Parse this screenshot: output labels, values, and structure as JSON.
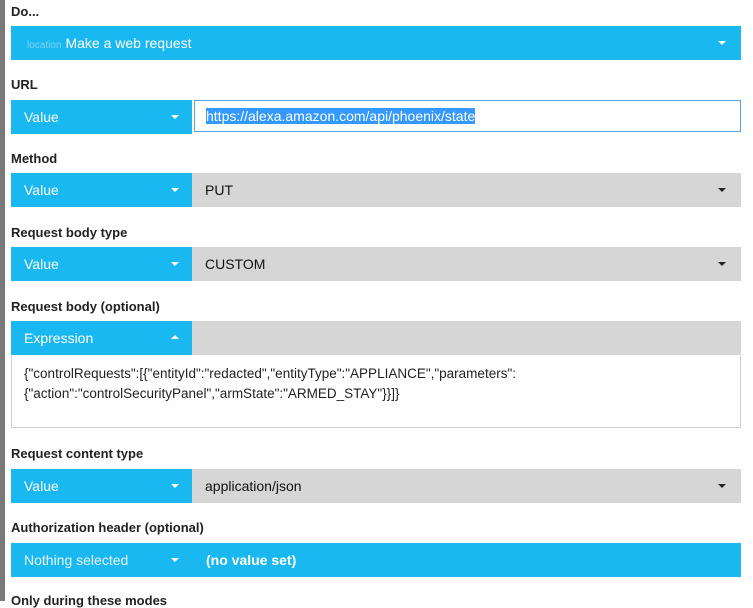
{
  "do_section": {
    "label": "Do...",
    "location_tag": "location",
    "action_value": "Make a web request"
  },
  "url": {
    "label": "URL",
    "mode": "Value",
    "value": "https://alexa.amazon.com/api/phoenix/state"
  },
  "method": {
    "label": "Method",
    "mode": "Value",
    "value": "PUT"
  },
  "body_type": {
    "label": "Request body type",
    "mode": "Value",
    "value": "CUSTOM"
  },
  "body": {
    "label": "Request body (optional)",
    "mode": "Expression",
    "line1": "{\"controlRequests\":[{\"entityId\":\"redacted\",\"entityType\":\"APPLIANCE\",\"parameters\":",
    "line2": "{\"action\":\"controlSecurityPanel\",\"armState\":\"ARMED_STAY\"}}]}"
  },
  "content_type": {
    "label": "Request content type",
    "mode": "Value",
    "value": "application/json"
  },
  "auth": {
    "label": "Authorization header (optional)",
    "mode": "Nothing selected",
    "value": "(no value set)"
  },
  "modes": {
    "label": "Only during these modes"
  },
  "colors": {
    "accent": "#1ab8f0",
    "select_bg": "#d6d6d6",
    "left_bar": "#7a7a7a"
  }
}
